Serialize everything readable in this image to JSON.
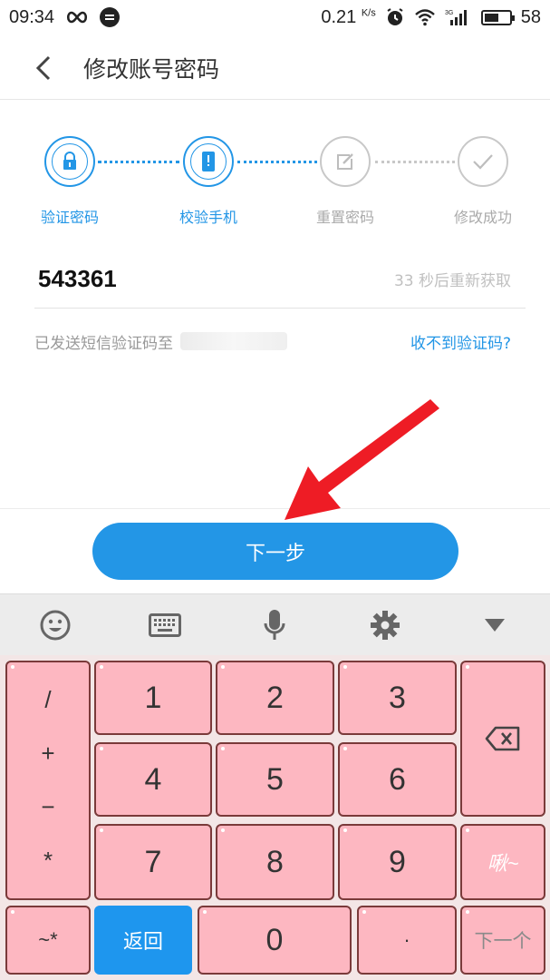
{
  "status_bar": {
    "time": "09:34",
    "speed_value": "0.21",
    "speed_unit": "K/s",
    "battery": "58",
    "battery_level": 0.58
  },
  "header": {
    "title": "修改账号密码"
  },
  "steps": [
    {
      "label": "验证密码",
      "icon": "lock-icon",
      "active": true
    },
    {
      "label": "校验手机",
      "icon": "phone-icon",
      "active": true
    },
    {
      "label": "重置密码",
      "icon": "edit-icon",
      "active": false
    },
    {
      "label": "修改成功",
      "icon": "check-icon",
      "active": false
    }
  ],
  "verification": {
    "code_value": "543361",
    "resend_countdown": "33 秒后重新获取",
    "sent_text": "已发送短信验证码至",
    "no_code_link": "收不到验证码?"
  },
  "next_button": "下一步",
  "keyboard": {
    "symbols": [
      "/",
      "+",
      "−",
      "*"
    ],
    "digits": [
      "1",
      "2",
      "3",
      "4",
      "5",
      "6",
      "7",
      "8",
      "9",
      "0"
    ],
    "bottom_left": "~*",
    "return_key": "返回",
    "dot_key": "·",
    "emote_key": "啾~",
    "next_key": "下一个"
  },
  "colors": {
    "accent": "#2396e6",
    "key_pink": "#fdb7c1",
    "arrow_red": "#ee1c25"
  }
}
